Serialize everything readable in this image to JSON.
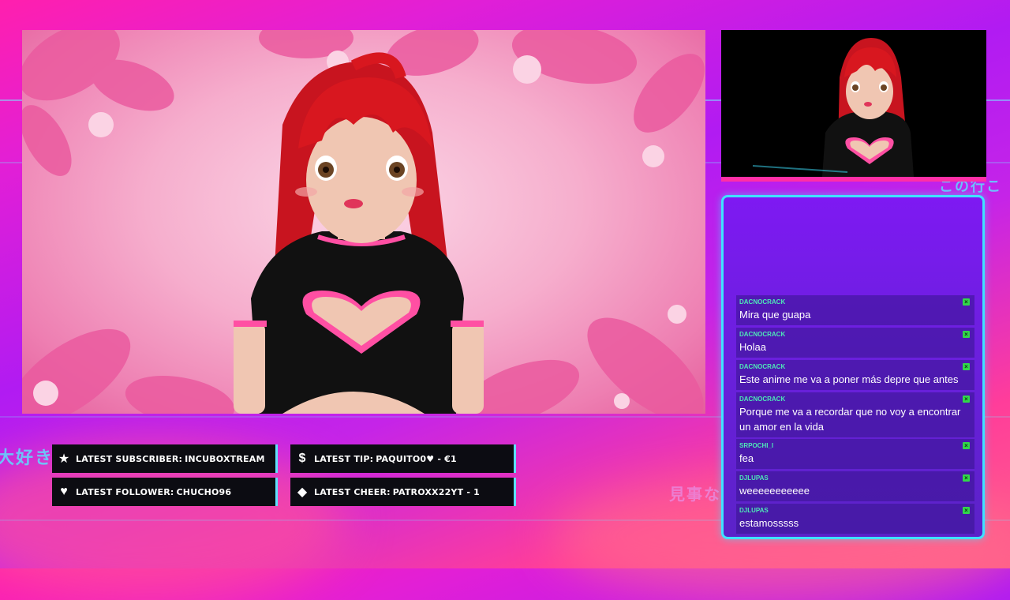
{
  "overlay": {
    "deco_text_top_right": "この行こ",
    "deco_text_left": "大好き",
    "deco_text_mid": "見事な"
  },
  "alerts": {
    "subscriber": {
      "label": "LATEST SUBSCRIBER:",
      "value": "INCUBOXTREAM",
      "icon": "star-icon"
    },
    "tip": {
      "label": "LATEST TIP:",
      "value": "PAQUITO0♥ - €1",
      "icon": "dollar-icon"
    },
    "follower": {
      "label": "LATEST FOLLOWER:",
      "value": "CHUCHO96",
      "icon": "heart-icon"
    },
    "cheer": {
      "label": "LATEST CHEER:",
      "value": "PATROXX22YT - 1",
      "icon": "diamond-icon"
    }
  },
  "chat": {
    "messages": [
      {
        "user": "DACNOCRACK",
        "text": "Mira que guapa"
      },
      {
        "user": "DACNOCRACK",
        "text": "Holaa"
      },
      {
        "user": "DACNOCRACK",
        "text": "Este anime me va a poner más depre que antes"
      },
      {
        "user": "DACNOCRACK",
        "text": "Porque me va a recordar que no voy a encontrar un amor en la vida"
      },
      {
        "user": "SRPOCHI_I",
        "text": "fea"
      },
      {
        "user": "DJLUPAS",
        "text": "weeeeeeeeeee"
      },
      {
        "user": "DJLUPAS",
        "text": "estamosssss"
      }
    ]
  },
  "colors": {
    "accent_cyan": "#3fe2ff",
    "accent_pink": "#ff2fa6",
    "chat_user": "#4ee7b8",
    "badge_green": "#32d74b"
  }
}
